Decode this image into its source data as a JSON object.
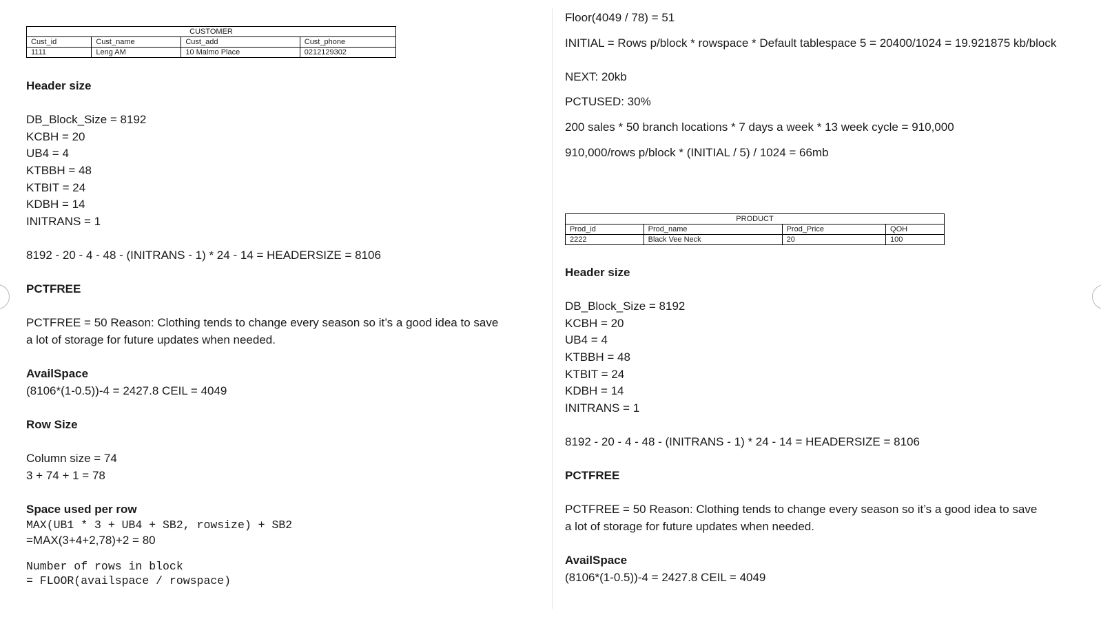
{
  "left": {
    "customer_table": {
      "caption": "CUSTOMER",
      "headers": [
        "Cust_id",
        "Cust_name",
        "Cust_add",
        "Cust_phone"
      ],
      "row": [
        "1111",
        "Leng AM",
        "10 Malmo Place",
        "0212129302"
      ]
    },
    "header_size_title": "Header size",
    "header_lines": [
      "DB_Block_Size = 8192",
      "KCBH = 20",
      "UB4 = 4",
      "KTBBH = 48",
      "KTBIT = 24",
      "KDBH = 14",
      "INITRANS = 1"
    ],
    "header_formula": "8192 - 20 - 4 - 48 - (INITRANS - 1) * 24 - 14 = HEADERSIZE = 8106",
    "pctfree_title": "PCTFREE",
    "pctfree_text": "PCTFREE = 50 Reason: Clothing tends to change every season so it’s a good idea to save a lot of storage for future updates when needed.",
    "availspace_title": "AvailSpace",
    "availspace_text": "(8106*(1-0.5))-4 = 2427.8 CEIL = 4049",
    "rowsize_title": "Row Size",
    "rowsize_lines": [
      "Column size = 74",
      "3 + 74 + 1 = 78"
    ],
    "space_title": "Space used per row",
    "space_mono": "MAX(UB1 * 3 + UB4 + SB2, rowsize) + SB2",
    "space_calc": "=MAX(3+4+2,78)+2 = 80",
    "rows_mono_1": "Number of rows in block",
    "rows_mono_2": "= FLOOR(availspace / rowspace)"
  },
  "right": {
    "floor_line": "Floor(4049 / 78) = 51",
    "initial_text": "INITIAL = Rows p/block * rowspace * Default tablespace 5 = 20400/1024 = 19.921875 kb/block",
    "next_text": "NEXT: 20kb",
    "pctused_text": "PCTUSED: 30%",
    "sales_text": "200 sales * 50 branch locations * 7 days a week * 13 week cycle = 910,000",
    "size_text": "910,000/rows p/block * (INITIAL / 5) / 1024 = 66mb",
    "product_table": {
      "caption": "PRODUCT",
      "headers": [
        "Prod_id",
        "Prod_name",
        "Prod_Price",
        "QOH"
      ],
      "row": [
        "2222",
        "Black Vee Neck",
        "20",
        "100"
      ]
    },
    "header_size_title": "Header size",
    "header_lines": [
      "DB_Block_Size = 8192",
      "KCBH = 20",
      "UB4 = 4",
      "KTBBH = 48",
      "KTBIT = 24",
      "KDBH = 14",
      "INITRANS = 1"
    ],
    "header_formula": "8192 - 20 - 4 - 48 - (INITRANS - 1) * 24 - 14 = HEADERSIZE = 8106",
    "pctfree_title": "PCTFREE",
    "pctfree_text": "PCTFREE = 50 Reason: Clothing tends to change every season so it’s a good idea to save a lot of storage for future updates when needed.",
    "availspace_title": "AvailSpace",
    "availspace_text": "(8106*(1-0.5))-4 = 2427.8 CEIL = 4049"
  }
}
